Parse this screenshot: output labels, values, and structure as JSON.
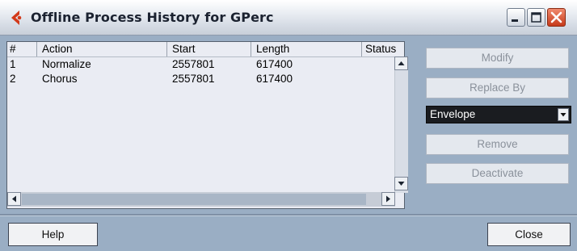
{
  "window": {
    "title": "Offline Process History for GPerc",
    "accent_color": "#d33a1a"
  },
  "list": {
    "columns": [
      "#",
      "Action",
      "Start",
      "Length",
      "Status"
    ],
    "rows": [
      {
        "num": "1",
        "action": "Normalize",
        "start": "2557801",
        "length": "617400",
        "status": ""
      },
      {
        "num": "2",
        "action": "Chorus",
        "start": "2557801",
        "length": "617400",
        "status": ""
      }
    ]
  },
  "actions": {
    "modify_label": "Modify",
    "replace_label": "Replace By",
    "replace_selected": "Envelope",
    "remove_label": "Remove",
    "deactivate_label": "Deactivate"
  },
  "footer": {
    "help_label": "Help",
    "close_label": "Close"
  }
}
